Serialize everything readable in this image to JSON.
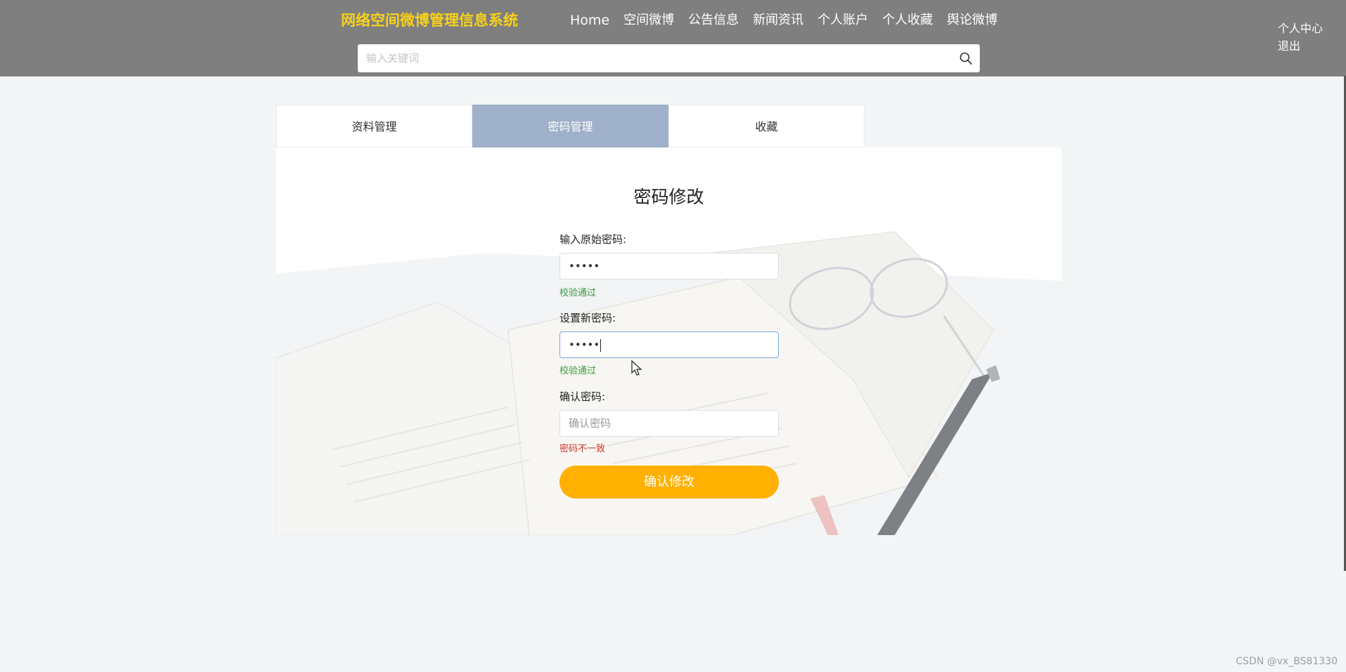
{
  "header": {
    "brand": "网络空间微博管理信息系统",
    "nav": [
      "Home",
      "空间微博",
      "公告信息",
      "新闻资讯",
      "个人账户",
      "个人收藏",
      "舆论微博"
    ],
    "user_center": "个人中心",
    "logout": "退出",
    "search": {
      "placeholder": "输入关键词",
      "value": "",
      "icon": "search-icon"
    }
  },
  "tabs": [
    {
      "label": "资料管理",
      "active": false
    },
    {
      "label": "密码管理",
      "active": true
    },
    {
      "label": "收藏",
      "active": false
    }
  ],
  "form": {
    "title": "密码修改",
    "old_password": {
      "label": "输入原始密码:",
      "value": "•••••",
      "status": "校验通过"
    },
    "new_password": {
      "label": "设置新密码:",
      "value": "•••••",
      "status": "校验通过"
    },
    "confirm_password": {
      "label": "确认密码:",
      "placeholder": "确认密码",
      "value": "",
      "status": "密码不一致"
    },
    "submit_label": "确认修改"
  },
  "colors": {
    "topbar": "#7f7f7f",
    "brand": "#f7d11c",
    "active_tab": "#9fb0ca",
    "submit": "#ffb000",
    "ok": "#3a9a3a",
    "error": "#d0342c"
  },
  "watermark": "CSDN @vx_BS81330"
}
